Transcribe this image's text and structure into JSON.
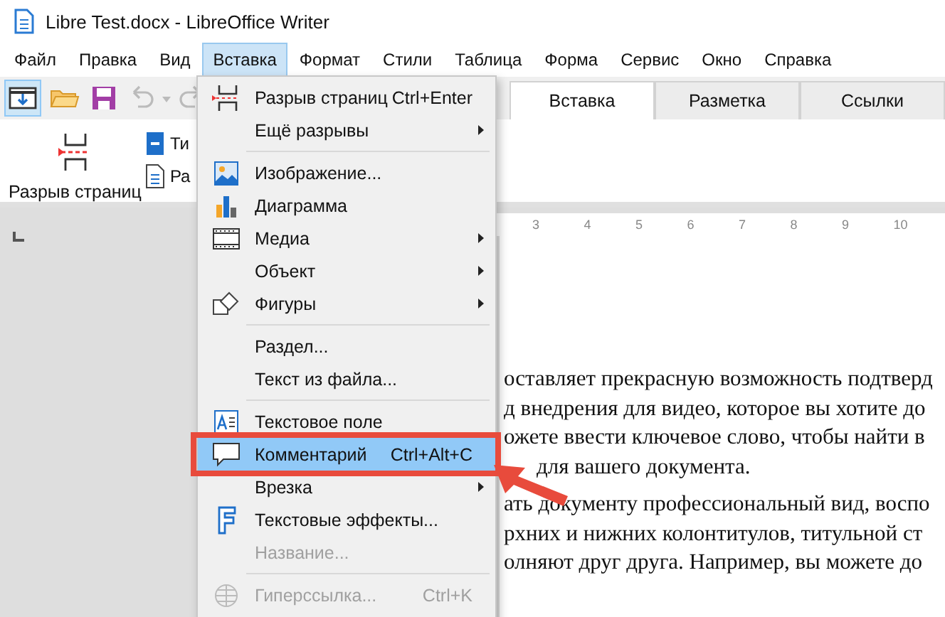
{
  "window": {
    "title": "Libre Test.docx - LibreOffice Writer"
  },
  "menubar": [
    {
      "label": "Файл",
      "selected": false
    },
    {
      "label": "Правка",
      "selected": false
    },
    {
      "label": "Вид",
      "selected": false
    },
    {
      "label": "Вставка",
      "selected": true
    },
    {
      "label": "Формат",
      "selected": false
    },
    {
      "label": "Стили",
      "selected": false
    },
    {
      "label": "Таблица",
      "selected": false
    },
    {
      "label": "Форма",
      "selected": false
    },
    {
      "label": "Сервис",
      "selected": false
    },
    {
      "label": "Окно",
      "selected": false
    },
    {
      "label": "Справка",
      "selected": false
    }
  ],
  "notebookbar": {
    "tabs": [
      {
        "label": "Вставка",
        "selected": true
      },
      {
        "label": "Разметка",
        "selected": false
      },
      {
        "label": "Ссылки",
        "selected": false
      }
    ],
    "page_break_button": "Разрыв страниц",
    "small_buttons": [
      "Ти",
      "Ра"
    ]
  },
  "ruler": {
    "ticks": [
      "3",
      "4",
      "5",
      "6",
      "7",
      "8",
      "9",
      "10"
    ]
  },
  "document": {
    "lines": [
      "оставляет прекрасную возможность подтверд",
      "д внедрения для видео, которое вы хотите до",
      "ожете ввести ключевое слово, чтобы найти в",
      "для вашего документа.",
      "ать документу профессиональный вид, воспо",
      "рхних и нижних колонтитулов, титульной ст",
      "олняют друг друга. Например, вы можете до"
    ]
  },
  "menu": {
    "items": [
      {
        "kind": "item",
        "label": "Разрыв страниц",
        "shortcut": "Ctrl+Enter",
        "submenu": false,
        "selected": false,
        "disabled": false
      },
      {
        "kind": "item",
        "label": "Ещё разрывы",
        "submenu": true,
        "selected": false,
        "disabled": false
      },
      {
        "kind": "separator"
      },
      {
        "kind": "item",
        "label": "Изображение...",
        "submenu": false,
        "selected": false,
        "disabled": false
      },
      {
        "kind": "item",
        "label": "Диаграмма",
        "submenu": false,
        "selected": false,
        "disabled": false
      },
      {
        "kind": "item",
        "label": "Медиа",
        "submenu": true,
        "selected": false,
        "disabled": false
      },
      {
        "kind": "item",
        "label": "Объект",
        "submenu": true,
        "selected": false,
        "disabled": false
      },
      {
        "kind": "item",
        "label": "Фигуры",
        "submenu": true,
        "selected": false,
        "disabled": false
      },
      {
        "kind": "separator"
      },
      {
        "kind": "item",
        "label": "Раздел...",
        "submenu": false,
        "selected": false,
        "disabled": false
      },
      {
        "kind": "item",
        "label": "Текст из файла...",
        "submenu": false,
        "selected": false,
        "disabled": false
      },
      {
        "kind": "separator"
      },
      {
        "kind": "item",
        "label": "Текстовое поле",
        "submenu": false,
        "selected": false,
        "disabled": false
      },
      {
        "kind": "item",
        "label": "Комментарий",
        "shortcut": "Ctrl+Alt+C",
        "submenu": false,
        "selected": true,
        "disabled": false
      },
      {
        "kind": "item",
        "label": "Врезка",
        "submenu": true,
        "selected": false,
        "disabled": false
      },
      {
        "kind": "item",
        "label": "Текстовые эффекты...",
        "submenu": false,
        "selected": false,
        "disabled": false
      },
      {
        "kind": "item",
        "label": "Название...",
        "submenu": false,
        "selected": false,
        "disabled": true
      },
      {
        "kind": "separator"
      },
      {
        "kind": "item",
        "label": "Гиперссылка...",
        "shortcut": "Ctrl+K",
        "submenu": false,
        "selected": false,
        "disabled": true
      }
    ]
  }
}
